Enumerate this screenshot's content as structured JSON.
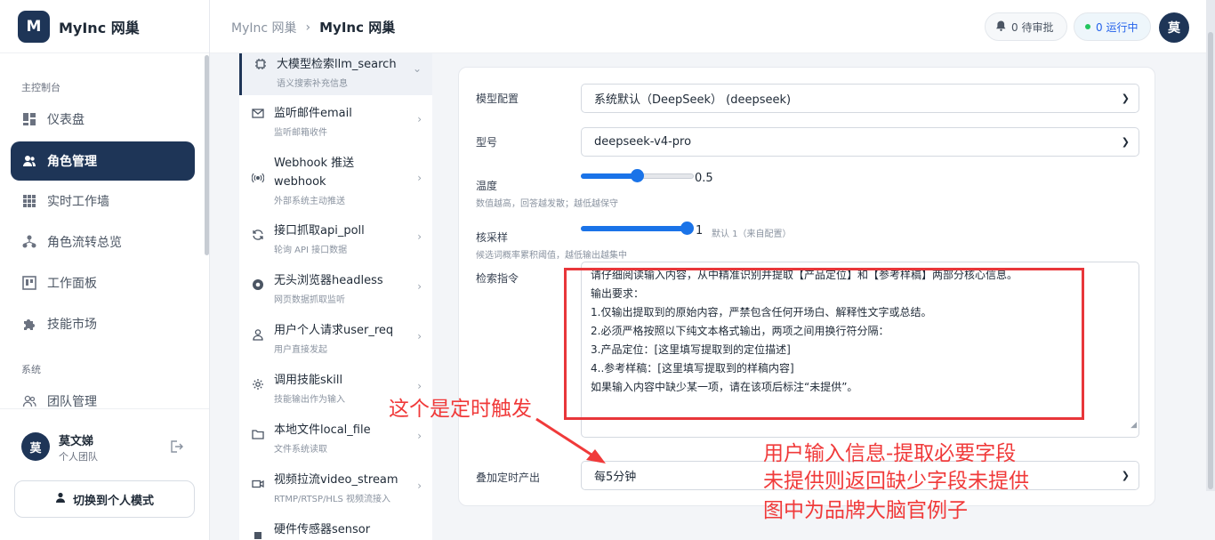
{
  "app": {
    "logo_letter": "M",
    "name": "MyInc 网巢"
  },
  "sidebar": {
    "section_main": "主控制台",
    "section_system": "系统",
    "items": [
      {
        "label": "仪表盘",
        "icon": "dashboard-icon"
      },
      {
        "label": "角色管理",
        "icon": "users-icon",
        "active": true
      },
      {
        "label": "实时工作墙",
        "icon": "grid-icon"
      },
      {
        "label": "角色流转总览",
        "icon": "flow-icon"
      },
      {
        "label": "工作面板",
        "icon": "kanban-icon"
      },
      {
        "label": "技能市场",
        "icon": "puzzle-icon"
      }
    ],
    "system_items": [
      {
        "label": "团队管理",
        "icon": "team-icon"
      }
    ],
    "user": {
      "avatar": "莫",
      "name": "莫文娣",
      "team": "个人团队"
    },
    "switch_button": "切换到个人模式"
  },
  "header": {
    "breadcrumb_parent": "MyInc 网巢",
    "breadcrumb_current": "MyInc 网巢",
    "pending": "0 待审批",
    "running": "0 运行中",
    "avatar": "莫"
  },
  "triggers": [
    {
      "title": "大模型检索llm_search",
      "sub": "语义搜索补充信息",
      "icon": "chip-icon",
      "active": true
    },
    {
      "title": "监听邮件email",
      "sub": "监听邮箱收件",
      "icon": "mail-icon"
    },
    {
      "title": "Webhook 推送",
      "title2": "webhook",
      "sub": "外部系统主动推送",
      "icon": "broadcast-icon"
    },
    {
      "title": "接口抓取api_poll",
      "sub": "轮询 API 接口数据",
      "icon": "refresh-icon"
    },
    {
      "title": "无头浏览器headless",
      "sub": "网页数据抓取监听",
      "icon": "browser-icon"
    },
    {
      "title": "用户个人请求user_req",
      "sub": "用户直接发起",
      "icon": "user-icon"
    },
    {
      "title": "调用技能skill",
      "sub": "技能输出作为输入",
      "icon": "gear-icon"
    },
    {
      "title": "本地文件local_file",
      "sub": "文件系统读取",
      "icon": "folder-icon"
    },
    {
      "title": "视频拉流video_stream",
      "sub": "RTMP/RTSP/HLS 视频流接入",
      "icon": "video-icon"
    },
    {
      "title": "硬件传感器sensor",
      "sub": "",
      "icon": "sensor-icon"
    }
  ],
  "config": {
    "model_label": "模型配置",
    "model_value": "系统默认（DeepSeek） (deepseek)",
    "type_label": "型号",
    "type_value": "deepseek-v4-pro",
    "temp_label": "温度",
    "temp_hint": "数值越高，回答越发散；越低越保守",
    "temp_value": "0.5",
    "temp_fraction": 0.5,
    "topp_label": "核采样",
    "topp_hint": "候选词概率累积阈值，越低输出越集中",
    "topp_value": "1",
    "topp_fraction": 1.0,
    "topp_default": "默认 1（来自配置）",
    "prompt_label": "检索指令",
    "prompt_lines": [
      "请仔细阅读输入内容，从中精准识别并提取【产品定位】和【参考样稿】两部分核心信息。",
      "输出要求：",
      "1.仅输出提取到的原始内容，严禁包含任何开场白、解释性文字或总结。",
      "2.必须严格按照以下纯文本格式输出，两项之间用换行符分隔：",
      "3.产品定位：[这里填写提取到的定位描述]",
      "4..参考样稿：[这里填写提取到的样稿内容]",
      "如果输入内容中缺少某一项，请在该项后标注“未提供”。"
    ],
    "schedule_label": "叠加定时产出",
    "schedule_value": "每5分钟"
  },
  "annotations": {
    "timer_note": "这个是定时触发",
    "note_line1": "用户输入信息-提取必要字段",
    "note_line2": "未提供则返回缺少字段未提供",
    "note_line3": "图中为品牌大脑官例子"
  },
  "colors": {
    "primary": "#1e3557",
    "accent": "#1a73e8",
    "annotation": "#f03a3a"
  }
}
